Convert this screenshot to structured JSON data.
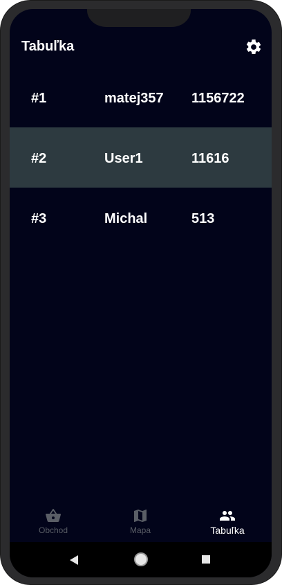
{
  "appbar": {
    "title": "Tabuľka",
    "settings_icon": "gear-icon"
  },
  "leaderboard": {
    "rows": [
      {
        "rank": "#1",
        "name": "matej357",
        "score": "1156722",
        "highlighted": false
      },
      {
        "rank": "#2",
        "name": "User1",
        "score": "11616",
        "highlighted": true
      },
      {
        "rank": "#3",
        "name": "Michal",
        "score": "513",
        "highlighted": false
      }
    ]
  },
  "bottom_nav": {
    "items": [
      {
        "label": "Obchod",
        "icon": "basket-icon",
        "active": false
      },
      {
        "label": "Mapa",
        "icon": "map-icon",
        "active": false
      },
      {
        "label": "Tabuľka",
        "icon": "people-icon",
        "active": true
      }
    ]
  },
  "system_nav": {
    "back": "back-triangle-icon",
    "home": "home-circle-icon",
    "recents": "recents-square-icon"
  },
  "colors": {
    "background": "#02041a",
    "highlight_row": "#2d3a40",
    "inactive": "#5a5e66",
    "active": "#ffffff"
  }
}
